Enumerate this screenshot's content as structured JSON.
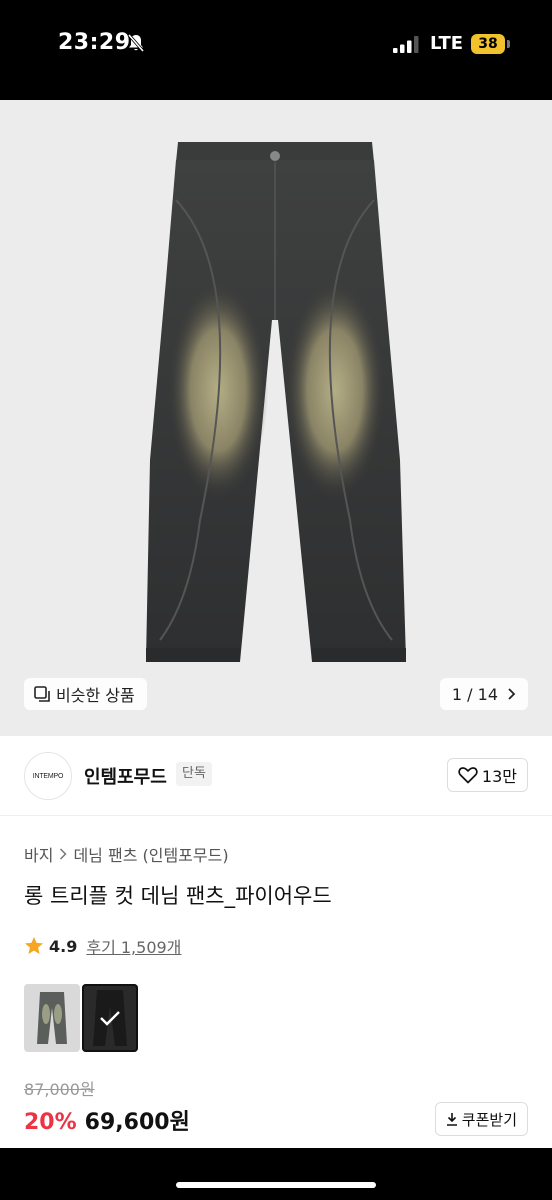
{
  "status_bar": {
    "time": "23:29",
    "network": "LTE",
    "battery": "38",
    "icons": [
      "bell-slash-icon",
      "signal-icon",
      "battery-icon"
    ],
    "battery_color": "#f2c12e"
  },
  "gallery": {
    "similar_label": "비슷한 상품",
    "counter": "1 / 14",
    "current_index": 1,
    "total": 14
  },
  "brand": {
    "logo_text": "INTEMPO",
    "name": "인템포무드",
    "badge": "단독",
    "like_count": "13만"
  },
  "breadcrumb": {
    "category": "바지",
    "subcategory": "데님 팬츠 (인템포무드)"
  },
  "product": {
    "title": "롱 트리플 컷 데님 팬츠_파이어우드",
    "rating": "4.9",
    "reviews": "후기 1,509개",
    "thumbnails": [
      "light-wash",
      "black-wash"
    ],
    "original_price": "87,000원",
    "discount": "20%",
    "sale_price": "69,600원",
    "coupon_label": "쿠폰받기"
  },
  "colors": {
    "discount": "#ee3344",
    "star": "#f5a623"
  }
}
